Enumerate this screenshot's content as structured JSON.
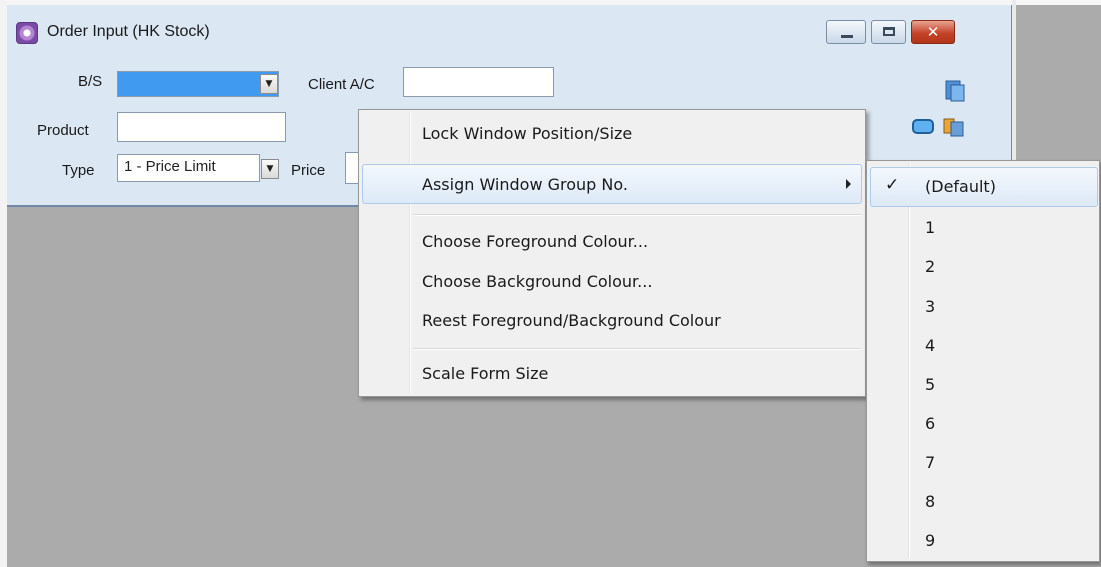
{
  "window": {
    "title": "Order Input (HK Stock)",
    "icon": "app-gear-icon"
  },
  "form": {
    "bs_label": "B/S",
    "bs_value": "",
    "client_label": "Client A/C",
    "client_value": "",
    "product_label": "Product",
    "product_value": "",
    "type_label": "Type",
    "type_value": "1 - Price Limit",
    "price_label": "Price",
    "price_value": ""
  },
  "context_menu": {
    "items": [
      {
        "label": "Lock Window Position/Size"
      },
      {
        "label": "Assign Window Group No.",
        "has_submenu": true,
        "highlighted": true
      },
      {
        "label": "Choose Foreground Colour..."
      },
      {
        "label": "Choose Background Colour..."
      },
      {
        "label": "Reest Foreground/Background Colour"
      },
      {
        "label": "Scale Form Size"
      }
    ]
  },
  "submenu": {
    "checked": "(Default)",
    "items": [
      "(Default)",
      "1",
      "2",
      "3",
      "4",
      "5",
      "6",
      "7",
      "8",
      "9"
    ]
  }
}
